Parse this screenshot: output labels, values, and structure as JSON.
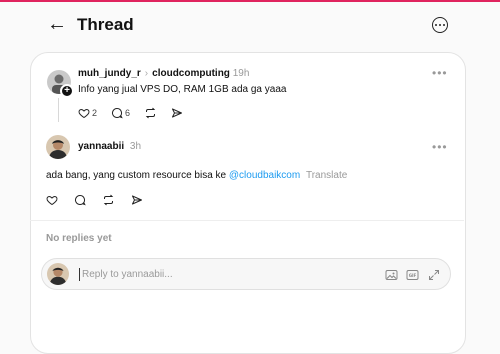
{
  "header": {
    "title": "Thread"
  },
  "parent_post": {
    "username": "muh_jundy_r",
    "community": "cloudcomputing",
    "time": "19h",
    "text": "Info yang jual VPS DO, RAM 1GB ada ga yaaa",
    "likes": "2",
    "replies": "6"
  },
  "reply_post": {
    "username": "yannaabii",
    "time": "3h",
    "text": "ada bang, yang custom resource bisa ke",
    "mention": "@cloudbaikcom",
    "translate_label": "Translate"
  },
  "replies_section": {
    "empty_label": "No replies yet"
  },
  "reply_input": {
    "placeholder": "Reply to yannaabii..."
  },
  "colors": {
    "accent_top": "#e0245e",
    "link": "#1d9bf0"
  }
}
